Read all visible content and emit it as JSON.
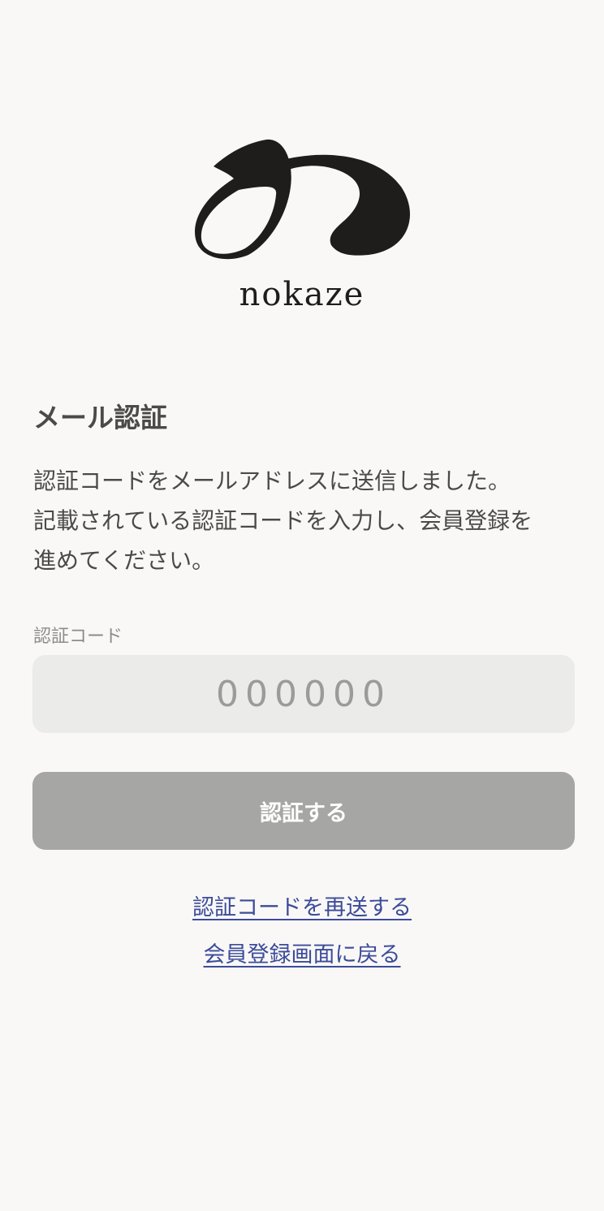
{
  "brand": {
    "logo_icon": "nokaze-logo-icon",
    "name": "nokaze"
  },
  "page": {
    "title": "メール認証",
    "description": [
      "認証コードをメールアドレスに送信しました。",
      "記載されている認証コードを入力し、会員登録を",
      "進めてください。"
    ]
  },
  "form": {
    "code_label": "認証コード",
    "code_placeholder": "000000",
    "code_value": "",
    "submit_label": "認証する"
  },
  "links": {
    "resend": "認証コードを再送する",
    "back": "会員登録画面に戻る"
  },
  "colors": {
    "background": "#f9f8f6",
    "text": "#4a4a48",
    "input_background": "#ebebea",
    "button_disabled": "#a6a6a4",
    "link": "#3c4b9a",
    "logo": "#1e1d1b"
  }
}
